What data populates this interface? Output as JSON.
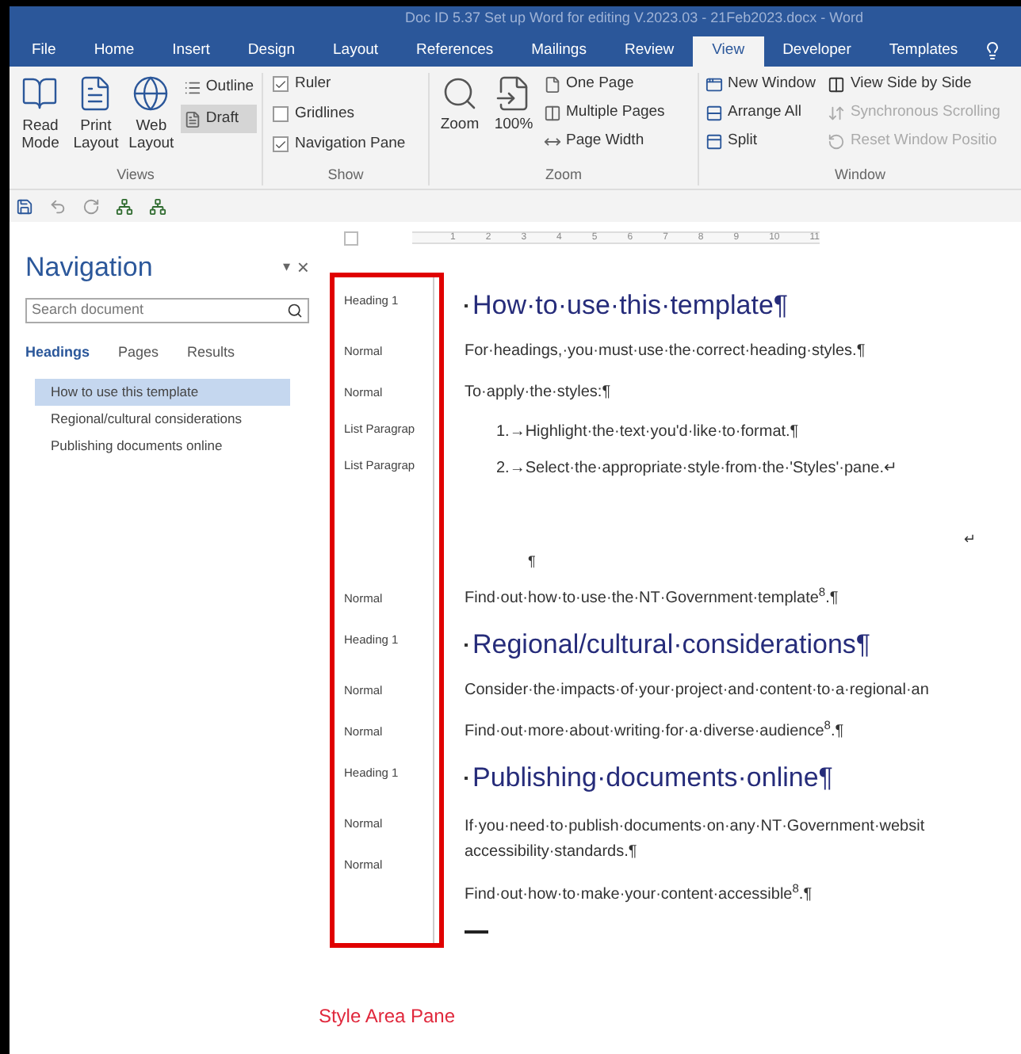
{
  "title_bar": {
    "title": "Doc ID 5.37 Set up Word for editing V.2023.03 - 21Feb2023.docx - Word"
  },
  "ribbon_tabs": [
    {
      "label": "File",
      "selected": false
    },
    {
      "label": "Home",
      "selected": false
    },
    {
      "label": "Insert",
      "selected": false
    },
    {
      "label": "Design",
      "selected": false
    },
    {
      "label": "Layout",
      "selected": false
    },
    {
      "label": "References",
      "selected": false
    },
    {
      "label": "Mailings",
      "selected": false
    },
    {
      "label": "Review",
      "selected": false
    },
    {
      "label": "View",
      "selected": true
    },
    {
      "label": "Developer",
      "selected": false
    },
    {
      "label": "Templates",
      "selected": false
    }
  ],
  "ribbon": {
    "views": {
      "label": "Views",
      "buttons": [
        {
          "label": "Read Mode"
        },
        {
          "label": "Print Layout"
        },
        {
          "label": "Web Layout"
        }
      ],
      "small": [
        {
          "label": "Outline",
          "selected": false
        },
        {
          "label": "Draft",
          "selected": true
        }
      ]
    },
    "show": {
      "label": "Show",
      "options": [
        {
          "label": "Ruler",
          "checked": true
        },
        {
          "label": "Gridlines",
          "checked": false
        },
        {
          "label": "Navigation Pane",
          "checked": true
        }
      ]
    },
    "zoom": {
      "label": "Zoom",
      "buttons": [
        {
          "label": "Zoom"
        },
        {
          "label": "100%"
        }
      ],
      "small": [
        {
          "label": "One Page"
        },
        {
          "label": "Multiple Pages"
        },
        {
          "label": "Page Width"
        }
      ]
    },
    "window": {
      "label": "Window",
      "left": [
        {
          "label": "New Window"
        },
        {
          "label": "Arrange All"
        },
        {
          "label": "Split"
        }
      ],
      "right": [
        {
          "label": "View Side by Side",
          "disabled": false
        },
        {
          "label": "Synchronous Scrolling",
          "disabled": true
        },
        {
          "label": "Reset Window Positio",
          "disabled": true
        }
      ]
    }
  },
  "navigation": {
    "title": "Navigation",
    "menu": "▾",
    "close": "×",
    "search": {
      "placeholder": "Search document"
    },
    "tabs": [
      {
        "label": "Headings",
        "selected": true
      },
      {
        "label": "Pages",
        "selected": false
      },
      {
        "label": "Results",
        "selected": false
      }
    ],
    "headings": [
      {
        "label": "How to use this template",
        "selected": true
      },
      {
        "label": "Regional/cultural considerations",
        "selected": false
      },
      {
        "label": "Publishing documents online",
        "selected": false
      }
    ]
  },
  "ruler": {
    "labels": [
      "1",
      "2",
      "3",
      "4",
      "5",
      "6",
      "7",
      "8",
      "9",
      "10",
      "11"
    ]
  },
  "document": {
    "rows": [
      {
        "kind": "heading",
        "style": "Heading 1",
        "lines": [
          "How·to·use·this·template¶"
        ]
      },
      {
        "kind": "normal",
        "style": "Normal",
        "lines": [
          "For·headings,·you·must·use·the·correct·heading·styles.¶"
        ]
      },
      {
        "kind": "normal",
        "style": "Normal",
        "lines": [
          "To·apply·the·styles:¶"
        ]
      },
      {
        "kind": "list",
        "style": "List Paragrap",
        "lines": [
          "1.→Highlight·the·text·you'd·like·to·format.¶"
        ]
      },
      {
        "kind": "list",
        "style": "List Paragrap",
        "lines": [
          "2.→Select·the·appropriate·style·from·the·'Styles'·pane.↵"
        ]
      },
      {
        "kind": "blank",
        "lines": [
          "↵",
          "¶"
        ]
      },
      {
        "kind": "normal",
        "style": "Normal",
        "lines": [
          "Find·out·how·to·use·the·NT·Government·template$^{8}$.¶"
        ]
      },
      {
        "kind": "heading",
        "style": "Heading 1",
        "lines": [
          "Regional/cultural·considerations¶"
        ]
      },
      {
        "kind": "normal",
        "style": "Normal",
        "lines": [
          "Consider·the·impacts·of·your·project·and·content·to·a·regional·an"
        ]
      },
      {
        "kind": "normal",
        "style": "Normal",
        "lines": [
          "Find·out·more·about·writing·for·a·diverse·audience$^{8}$.¶"
        ]
      },
      {
        "kind": "heading",
        "style": "Heading 1",
        "lines": [
          "Publishing·documents·online¶"
        ]
      },
      {
        "kind": "normal",
        "style": "Normal",
        "lines": [
          "If·you·need·to·publish·documents·on·any·NT·Government·websit",
          "accessibility·standards.¶"
        ]
      },
      {
        "kind": "normal",
        "style": "Normal",
        "lines": [
          "Find·out·how·to·make·your·content·accessible$^{8}$.¶"
        ]
      },
      {
        "kind": "separator"
      }
    ]
  },
  "annotation": {
    "caption": "Style Area Pane"
  }
}
